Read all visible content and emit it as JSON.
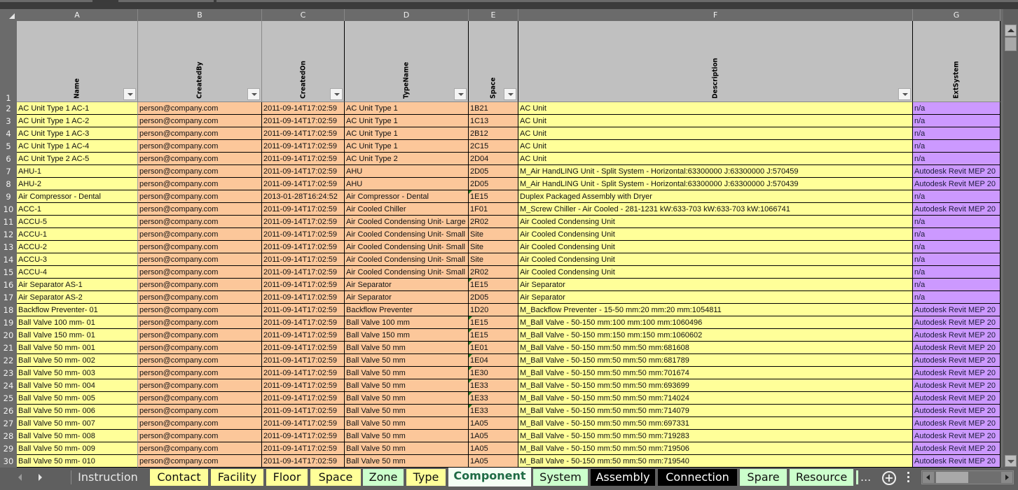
{
  "columns": [
    {
      "letter": "A",
      "header": "Name"
    },
    {
      "letter": "B",
      "header": "CreatedBy"
    },
    {
      "letter": "C",
      "header": "CreatedOn"
    },
    {
      "letter": "D",
      "header": "TypeName"
    },
    {
      "letter": "E",
      "header": "Space"
    },
    {
      "letter": "F",
      "header": "Description"
    },
    {
      "letter": "G",
      "header": "ExtSystem"
    }
  ],
  "header_row_number": "1",
  "rows": [
    {
      "n": "2",
      "cells": [
        "AC Unit Type 1 AC-1",
        "person@company.com",
        "2011-09-14T17:02:59",
        "AC Unit Type 1",
        "1B21",
        "AC Unit",
        "n/a"
      ]
    },
    {
      "n": "3",
      "cells": [
        "AC Unit Type 1 AC-2",
        "person@company.com",
        "2011-09-14T17:02:59",
        "AC Unit Type 1",
        "1C13",
        "AC Unit",
        "n/a"
      ]
    },
    {
      "n": "4",
      "cells": [
        "AC Unit Type 1 AC-3",
        "person@company.com",
        "2011-09-14T17:02:59",
        "AC Unit Type 1",
        "2B12",
        "AC Unit",
        "n/a"
      ]
    },
    {
      "n": "5",
      "cells": [
        "AC Unit Type 1 AC-4",
        "person@company.com",
        "2011-09-14T17:02:59",
        "AC Unit Type 1",
        "2C15",
        "AC Unit",
        "n/a"
      ]
    },
    {
      "n": "6",
      "cells": [
        "AC Unit Type 2 AC-5",
        "person@company.com",
        "2011-09-14T17:02:59",
        "AC Unit Type 2",
        "2D04",
        "AC Unit",
        "n/a"
      ]
    },
    {
      "n": "7",
      "cells": [
        "AHU-1",
        "person@company.com",
        "2011-09-14T17:02:59",
        "AHU",
        "2D05",
        "M_Air HandLING Unit - Split System - Horizontal:63300000 J:63300000 J:570459",
        "Autodesk Revit MEP 20"
      ]
    },
    {
      "n": "8",
      "cells": [
        "AHU-2",
        "person@company.com",
        "2011-09-14T17:02:59",
        "AHU",
        "2D05",
        "M_Air HandLING Unit - Split System - Horizontal:63300000 J:63300000 J:570439",
        "Autodesk Revit MEP 20"
      ]
    },
    {
      "n": "9",
      "cells": [
        "Air Compressor - Dental",
        "person@company.com",
        "2013-01-28T16:24:52",
        "Air Compressor - Dental",
        "1E15",
        "Duplex Packaged Assembly with Dryer",
        "n/a"
      ],
      "marker": true
    },
    {
      "n": "10",
      "cells": [
        "ACC-1",
        "person@company.com",
        "2011-09-14T17:02:59",
        "Air Cooled Chiller",
        "1F01",
        "M_Screw Chiller - Air Cooled - 281-1231 kW:633-703 kW:633-703 kW:1066741",
        "Autodesk Revit MEP 20"
      ]
    },
    {
      "n": "11",
      "cells": [
        "ACCU-5",
        "person@company.com",
        "2011-09-14T17:02:59",
        "Air Cooled Condensing Unit- Large",
        "2R02",
        "Air Cooled Condensing Unit",
        "n/a"
      ]
    },
    {
      "n": "12",
      "cells": [
        "ACCU-1",
        "person@company.com",
        "2011-09-14T17:02:59",
        "Air Cooled Condensing Unit- Small",
        "Site",
        "Air Cooled Condensing Unit",
        "n/a"
      ]
    },
    {
      "n": "13",
      "cells": [
        "ACCU-2",
        "person@company.com",
        "2011-09-14T17:02:59",
        "Air Cooled Condensing Unit- Small",
        "Site",
        "Air Cooled Condensing Unit",
        "n/a"
      ]
    },
    {
      "n": "14",
      "cells": [
        "ACCU-3",
        "person@company.com",
        "2011-09-14T17:02:59",
        "Air Cooled Condensing Unit- Small",
        "Site",
        "Air Cooled Condensing Unit",
        "n/a"
      ]
    },
    {
      "n": "15",
      "cells": [
        "ACCU-4",
        "person@company.com",
        "2011-09-14T17:02:59",
        "Air Cooled Condensing Unit- Small",
        "2R02",
        "Air Cooled Condensing Unit",
        "n/a"
      ]
    },
    {
      "n": "16",
      "cells": [
        "Air Separator AS-1",
        "person@company.com",
        "2011-09-14T17:02:59",
        "Air Separator",
        "1E15",
        "Air Separator",
        "n/a"
      ],
      "marker": true
    },
    {
      "n": "17",
      "cells": [
        "Air Separator AS-2",
        "person@company.com",
        "2011-09-14T17:02:59",
        "Air Separator",
        "2D05",
        "Air Separator",
        "n/a"
      ]
    },
    {
      "n": "18",
      "cells": [
        "Backflow Preventer- 01",
        "person@company.com",
        "2011-09-14T17:02:59",
        "Backflow Preventer",
        "1D20",
        "M_Backflow Preventer - 15-50 mm:20 mm:20 mm:1054811",
        "Autodesk Revit MEP 20"
      ]
    },
    {
      "n": "19",
      "cells": [
        "Ball Valve 100 mm- 01",
        "person@company.com",
        "2011-09-14T17:02:59",
        "Ball Valve 100 mm",
        "1E15",
        "M_Ball Valve - 50-150 mm:100 mm:100 mm:1060496",
        "Autodesk Revit MEP 20"
      ],
      "marker": true
    },
    {
      "n": "20",
      "cells": [
        "Ball Valve 150 mm- 01",
        "person@company.com",
        "2011-09-14T17:02:59",
        "Ball Valve 150 mm",
        "1E15",
        "M_Ball Valve - 50-150 mm:150 mm:150 mm:1060602",
        "Autodesk Revit MEP 20"
      ],
      "marker": true
    },
    {
      "n": "21",
      "cells": [
        "Ball Valve 50 mm- 001",
        "person@company.com",
        "2011-09-14T17:02:59",
        "Ball Valve 50 mm",
        "1E01",
        "M_Ball Valve - 50-150 mm:50 mm:50 mm:681608",
        "Autodesk Revit MEP 20"
      ],
      "marker": true
    },
    {
      "n": "22",
      "cells": [
        "Ball Valve 50 mm- 002",
        "person@company.com",
        "2011-09-14T17:02:59",
        "Ball Valve 50 mm",
        "1E04",
        "M_Ball Valve - 50-150 mm:50 mm:50 mm:681789",
        "Autodesk Revit MEP 20"
      ],
      "marker": true
    },
    {
      "n": "23",
      "cells": [
        "Ball Valve 50 mm- 003",
        "person@company.com",
        "2011-09-14T17:02:59",
        "Ball Valve 50 mm",
        "1E30",
        "M_Ball Valve - 50-150 mm:50 mm:50 mm:701674",
        "Autodesk Revit MEP 20"
      ],
      "marker": true
    },
    {
      "n": "24",
      "cells": [
        "Ball Valve 50 mm- 004",
        "person@company.com",
        "2011-09-14T17:02:59",
        "Ball Valve 50 mm",
        "1E33",
        "M_Ball Valve - 50-150 mm:50 mm:50 mm:693699",
        "Autodesk Revit MEP 20"
      ],
      "marker": true
    },
    {
      "n": "25",
      "cells": [
        "Ball Valve 50 mm- 005",
        "person@company.com",
        "2011-09-14T17:02:59",
        "Ball Valve 50 mm",
        "1E33",
        "M_Ball Valve - 50-150 mm:50 mm:50 mm:714024",
        "Autodesk Revit MEP 20"
      ],
      "marker": true
    },
    {
      "n": "26",
      "cells": [
        "Ball Valve 50 mm- 006",
        "person@company.com",
        "2011-09-14T17:02:59",
        "Ball Valve 50 mm",
        "1E33",
        "M_Ball Valve - 50-150 mm:50 mm:50 mm:714079",
        "Autodesk Revit MEP 20"
      ],
      "marker": true
    },
    {
      "n": "27",
      "cells": [
        "Ball Valve 50 mm- 007",
        "person@company.com",
        "2011-09-14T17:02:59",
        "Ball Valve 50 mm",
        "1A05",
        "M_Ball Valve - 50-150 mm:50 mm:50 mm:697331",
        "Autodesk Revit MEP 20"
      ]
    },
    {
      "n": "28",
      "cells": [
        "Ball Valve 50 mm- 008",
        "person@company.com",
        "2011-09-14T17:02:59",
        "Ball Valve 50 mm",
        "1A05",
        "M_Ball Valve - 50-150 mm:50 mm:50 mm:719283",
        "Autodesk Revit MEP 20"
      ]
    },
    {
      "n": "29",
      "cells": [
        "Ball Valve 50 mm- 009",
        "person@company.com",
        "2011-09-14T17:02:59",
        "Ball Valve 50 mm",
        "1A05",
        "M_Ball Valve - 50-150 mm:50 mm:50 mm:719506",
        "Autodesk Revit MEP 20"
      ]
    },
    {
      "n": "30",
      "cells": [
        "Ball Valve 50 mm- 010",
        "person@company.com",
        "2011-09-14T17:02:59",
        "Ball Valve 50 mm",
        "1A05",
        "M_Ball Valve - 50-150 mm:50 mm:50 mm:719540",
        "Autodesk Revit MEP 20"
      ]
    }
  ],
  "colors": {
    "yellow_cell": "#ffff99",
    "orange_cell": "#fcc79a",
    "purple_cell": "#cc99ff",
    "header_cell": "#c0c0c0",
    "active_tab_text": "#1f6b45"
  },
  "sheet_tabs": [
    {
      "label": "Instruction",
      "color": "none"
    },
    {
      "label": "Contact",
      "color": "#ffff99"
    },
    {
      "label": "Facility",
      "color": "#ffff99"
    },
    {
      "label": "Floor",
      "color": "#ffff99"
    },
    {
      "label": "Space",
      "color": "#ffff99"
    },
    {
      "label": "Zone",
      "color": "#ccffcc"
    },
    {
      "label": "Type",
      "color": "#ffff99"
    },
    {
      "label": "Component",
      "color": "#ffff99",
      "active": true
    },
    {
      "label": "System",
      "color": "#ccffcc"
    },
    {
      "label": "Assembly",
      "color": "#000000"
    },
    {
      "label": "Connection",
      "color": "#000000"
    },
    {
      "label": "Spare",
      "color": "#ccffcc"
    },
    {
      "label": "Resource",
      "color": "#ccffcc"
    }
  ],
  "tabbar": {
    "more_label": "...",
    "add_sheet_label": "+"
  }
}
